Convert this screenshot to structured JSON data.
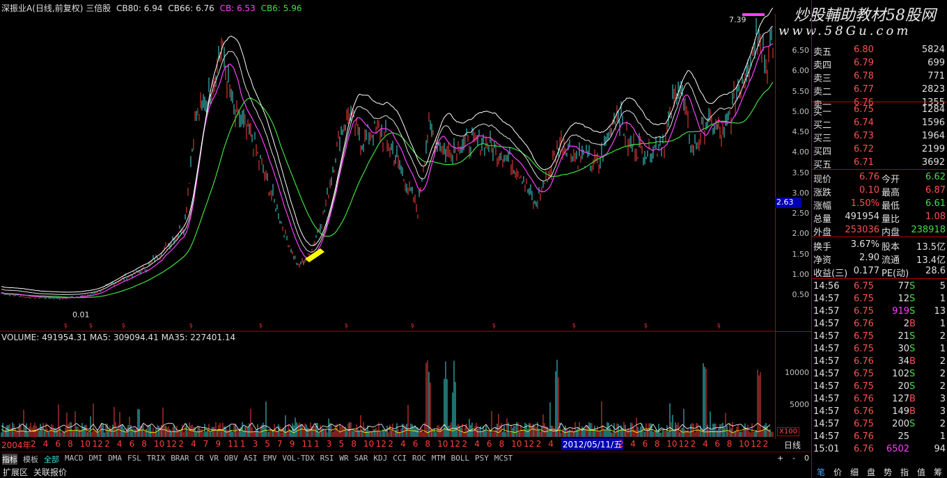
{
  "header": {
    "stock_name": "深振业A(日线,前复权) 三倍股",
    "cb80": "CB80: 6.94",
    "cb66": "CB66: 6.76",
    "cb": "CB: 6.53",
    "cb6": "CB6: 5.96"
  },
  "watermark": {
    "title": "炒股輔助教材58股网",
    "url": "www.58Gu.com"
  },
  "chart_labels": {
    "high_label": "7.39",
    "low_label": "0.01",
    "price_marker": "2.63",
    "volume_header": "VOLUME: 491954.31  MA5: 309094.41  MA35: 227401.14",
    "x100": "X100"
  },
  "price_axis": [
    "6.50",
    "6.00",
    "5.50",
    "5.00",
    "4.50",
    "4.00",
    "3.50",
    "3.00",
    "2.50",
    "2.00",
    "1.50",
    "1.00",
    "0.50"
  ],
  "volume_axis": [
    "10000",
    "5000"
  ],
  "date_axis": {
    "year_label": "2004年",
    "months": [
      "2",
      "4",
      "6",
      "8",
      "10",
      "12",
      "2",
      "4",
      "6",
      "8",
      "10",
      "12",
      "2",
      "4",
      "7",
      "9",
      "11",
      "1",
      "3",
      "5",
      "7",
      "9",
      "11",
      "1",
      "3",
      "5",
      "8",
      "10",
      "12",
      "2",
      "4",
      "6",
      "8",
      "10",
      "12",
      "2",
      "4",
      "6",
      "8",
      "10",
      "12",
      "2",
      "4"
    ],
    "months2": [
      "2",
      "4",
      "6",
      "8",
      "10",
      "12",
      "2",
      "4",
      "6",
      "8",
      "10",
      "12",
      "2"
    ],
    "highlight_date": "2012/05/11/五",
    "right_label": "日线"
  },
  "order_book": {
    "sell": [
      {
        "label": "卖五",
        "price": "6.80",
        "vol": "5824"
      },
      {
        "label": "卖四",
        "price": "6.79",
        "vol": "699"
      },
      {
        "label": "卖三",
        "price": "6.78",
        "vol": "771"
      },
      {
        "label": "卖二",
        "price": "6.77",
        "vol": "2823"
      },
      {
        "label": "卖一",
        "price": "6.76",
        "vol": "1355"
      }
    ],
    "buy": [
      {
        "label": "买一",
        "price": "6.75",
        "vol": "1284"
      },
      {
        "label": "买二",
        "price": "6.74",
        "vol": "1596"
      },
      {
        "label": "买三",
        "price": "6.73",
        "vol": "1964"
      },
      {
        "label": "买四",
        "price": "6.72",
        "vol": "2199"
      },
      {
        "label": "买五",
        "price": "6.71",
        "vol": "3692"
      }
    ]
  },
  "quote": {
    "r1": {
      "a": "现价",
      "av": "6.76",
      "b": "今开",
      "bv": "6.62"
    },
    "r2": {
      "a": "涨跌",
      "av": "0.10",
      "b": "最高",
      "bv": "6.87"
    },
    "r3": {
      "a": "涨幅",
      "av": "1.50%",
      "b": "最低",
      "bv": "6.61"
    },
    "r4": {
      "a": "总量",
      "av": "491954",
      "b": "量比",
      "bv": "1.08"
    },
    "r5": {
      "a": "外盘",
      "av": "253036",
      "b": "内盘",
      "bv": "238918"
    },
    "r6": {
      "a": "换手",
      "av": "3.67%",
      "b": "股本",
      "bv": "13.5亿"
    },
    "r7": {
      "a": "净资",
      "av": "2.90",
      "b": "流通",
      "bv": "13.4亿"
    },
    "r8": {
      "a": "收益(三)",
      "av": "0.177",
      "b": "PE(动)",
      "bv": "28.6"
    }
  },
  "ticks": [
    {
      "t": "14:56",
      "p": "6.75",
      "v": "77",
      "s": "S",
      "n": "5"
    },
    {
      "t": "14:57",
      "p": "6.75",
      "v": "12",
      "s": "S",
      "n": "1"
    },
    {
      "t": "14:57",
      "p": "6.75",
      "v": "919",
      "s": "S",
      "n": "13"
    },
    {
      "t": "14:57",
      "p": "6.76",
      "v": "2",
      "s": "B",
      "n": "1"
    },
    {
      "t": "14:57",
      "p": "6.75",
      "v": "21",
      "s": "S",
      "n": "2"
    },
    {
      "t": "14:57",
      "p": "6.75",
      "v": "30",
      "s": "S",
      "n": "1"
    },
    {
      "t": "14:57",
      "p": "6.76",
      "v": "34",
      "s": "B",
      "n": "2"
    },
    {
      "t": "14:57",
      "p": "6.75",
      "v": "102",
      "s": "S",
      "n": "2"
    },
    {
      "t": "14:57",
      "p": "6.75",
      "v": "20",
      "s": "S",
      "n": "2"
    },
    {
      "t": "14:57",
      "p": "6.76",
      "v": "127",
      "s": "B",
      "n": "3"
    },
    {
      "t": "14:57",
      "p": "6.76",
      "v": "149",
      "s": "B",
      "n": "3"
    },
    {
      "t": "14:57",
      "p": "6.75",
      "v": "200",
      "s": "S",
      "n": "2"
    },
    {
      "t": "14:57",
      "p": "6.76",
      "v": "25",
      "s": "",
      "n": "1"
    },
    {
      "t": "15:01",
      "p": "6.76",
      "v": "6502",
      "s": "",
      "n": "94"
    }
  ],
  "indicator_tabs": [
    "指标",
    "模板",
    "全部",
    "MACD",
    "DMI",
    "DMA",
    "FSL",
    "TRIX",
    "BRAR",
    "CR",
    "VR",
    "OBV",
    "ASI",
    "EMV",
    "VOL-TDX",
    "RSI",
    "WR",
    "SAR",
    "KDJ",
    "CCI",
    "ROC",
    "MTM",
    "BOLL",
    "PSY",
    "MCST"
  ],
  "bottom_tabs": [
    "扩展区",
    "关联报价"
  ],
  "side_tabs": [
    "笔",
    "价",
    "细",
    "盘",
    "势",
    "指",
    "值",
    "筹"
  ],
  "controls": [
    "+",
    "-",
    "0"
  ],
  "colors": {
    "red": "#ff5050",
    "green": "#40e040",
    "magenta": "#ff40ff",
    "cyan": "#40e0e0",
    "yellow": "#ffff00",
    "gridred": "#b00000"
  }
}
